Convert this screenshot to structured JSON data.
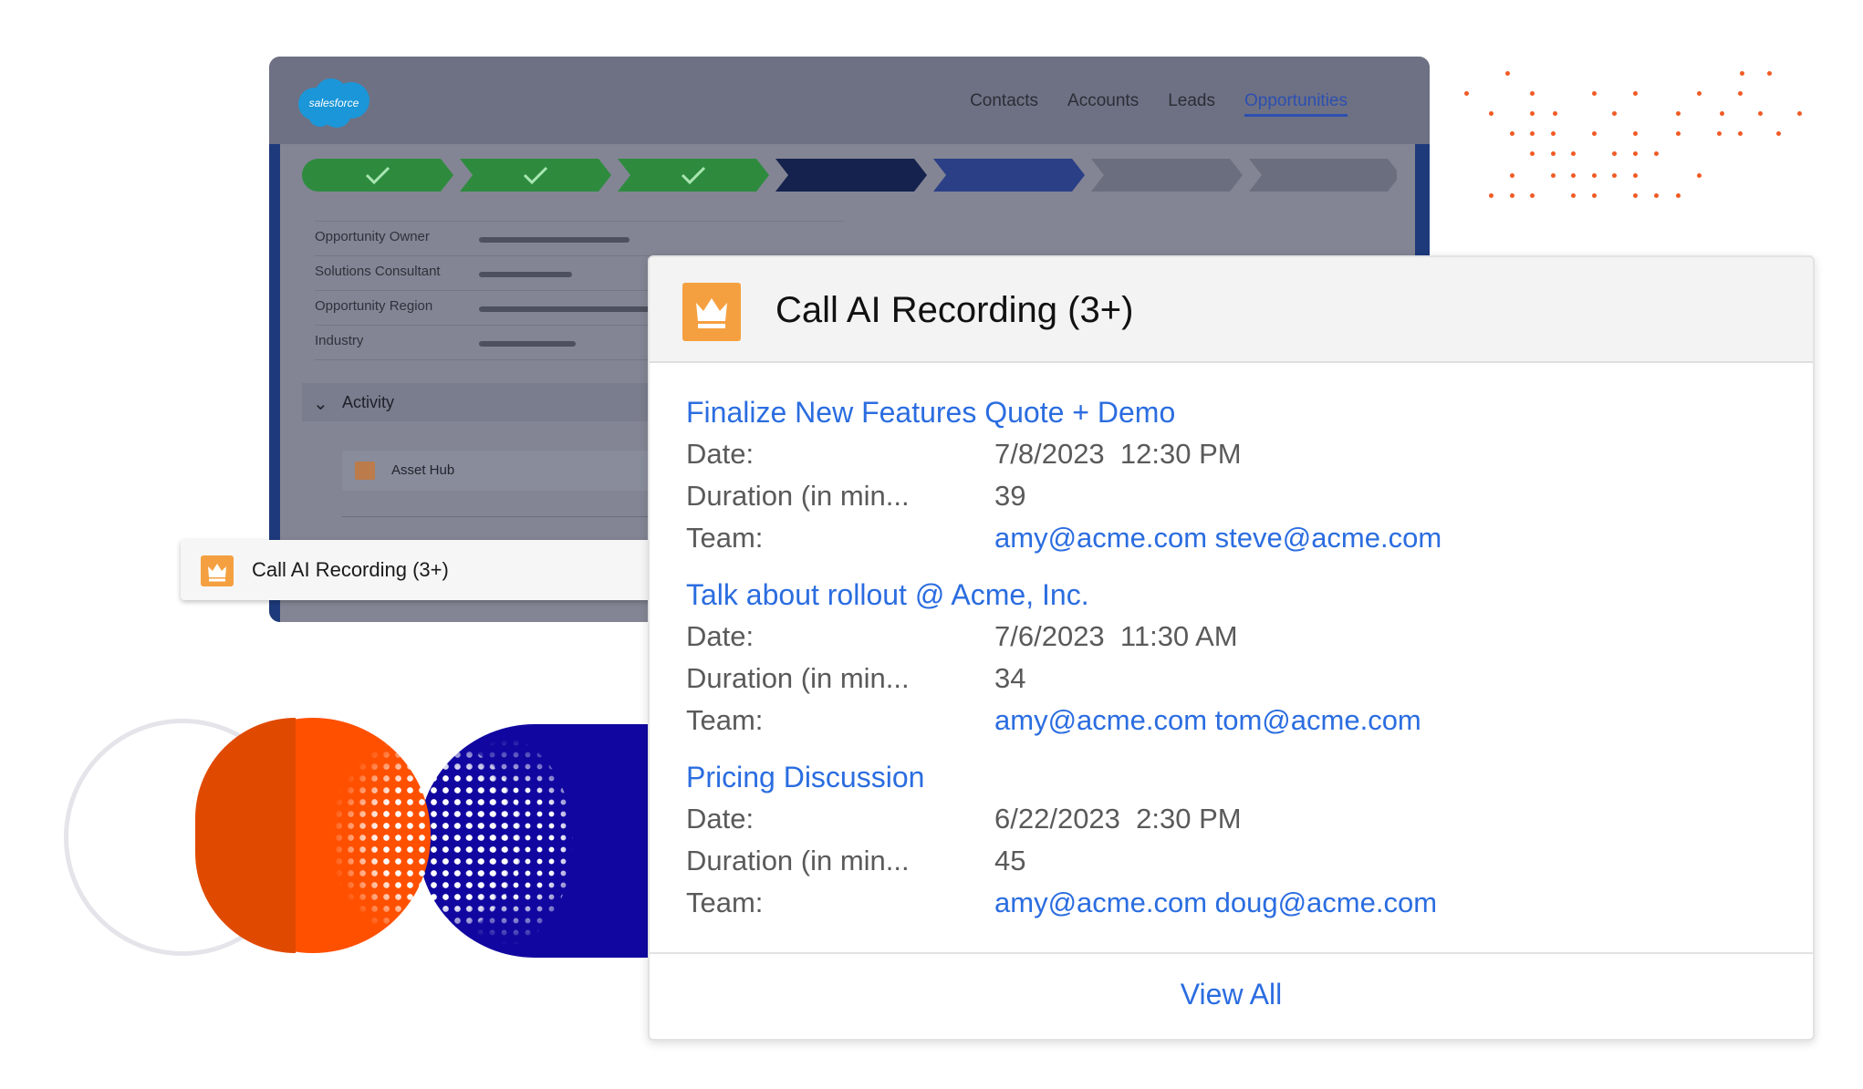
{
  "salesforce": {
    "logo_text": "salesforce",
    "nav": [
      "Contacts",
      "Accounts",
      "Leads",
      "Opportunities"
    ],
    "active_nav": "Opportunities",
    "fields": [
      "Opportunity Owner",
      "Solutions Consultant",
      "Opportunity Region",
      "Industry"
    ],
    "activity_label": "Activity",
    "asset_hub_label": "Asset Hub",
    "path_steps_complete": 3,
    "path_steps_total": 7
  },
  "small_card": {
    "title": "Call AI Recording (3+)",
    "icon": "crown-icon"
  },
  "card": {
    "title": "Call AI Recording (3+)",
    "icon": "crown-icon",
    "records": [
      {
        "title": "Finalize New Features Quote + Demo",
        "date_label": "Date:",
        "date_value": "7/8/2023  12:30 PM",
        "duration_label": "Duration (in min...",
        "duration_value": "39",
        "team_label": "Team:",
        "team_value": "amy@acme.com steve@acme.com"
      },
      {
        "title": "Talk about rollout @ Acme, Inc.",
        "date_label": "Date:",
        "date_value": "7/6/2023  11:30 AM",
        "duration_label": "Duration (in min...",
        "duration_value": "34",
        "team_label": "Team:",
        "team_value": "amy@acme.com tom@acme.com"
      },
      {
        "title": "Pricing Discussion",
        "date_label": "Date:",
        "date_value": "6/22/2023  2:30 PM",
        "duration_label": "Duration (in min...",
        "duration_value": "45",
        "team_label": "Team:",
        "team_value": "amy@acme.com doug@acme.com"
      }
    ],
    "view_all": "View All"
  },
  "colors": {
    "link_blue": "#2b6de0",
    "crown_orange": "#f5a040",
    "path_green": "#2e8b3e",
    "path_navy": "#14224d",
    "accent_orange": "#ff5000",
    "accent_blue": "#1107a0"
  }
}
